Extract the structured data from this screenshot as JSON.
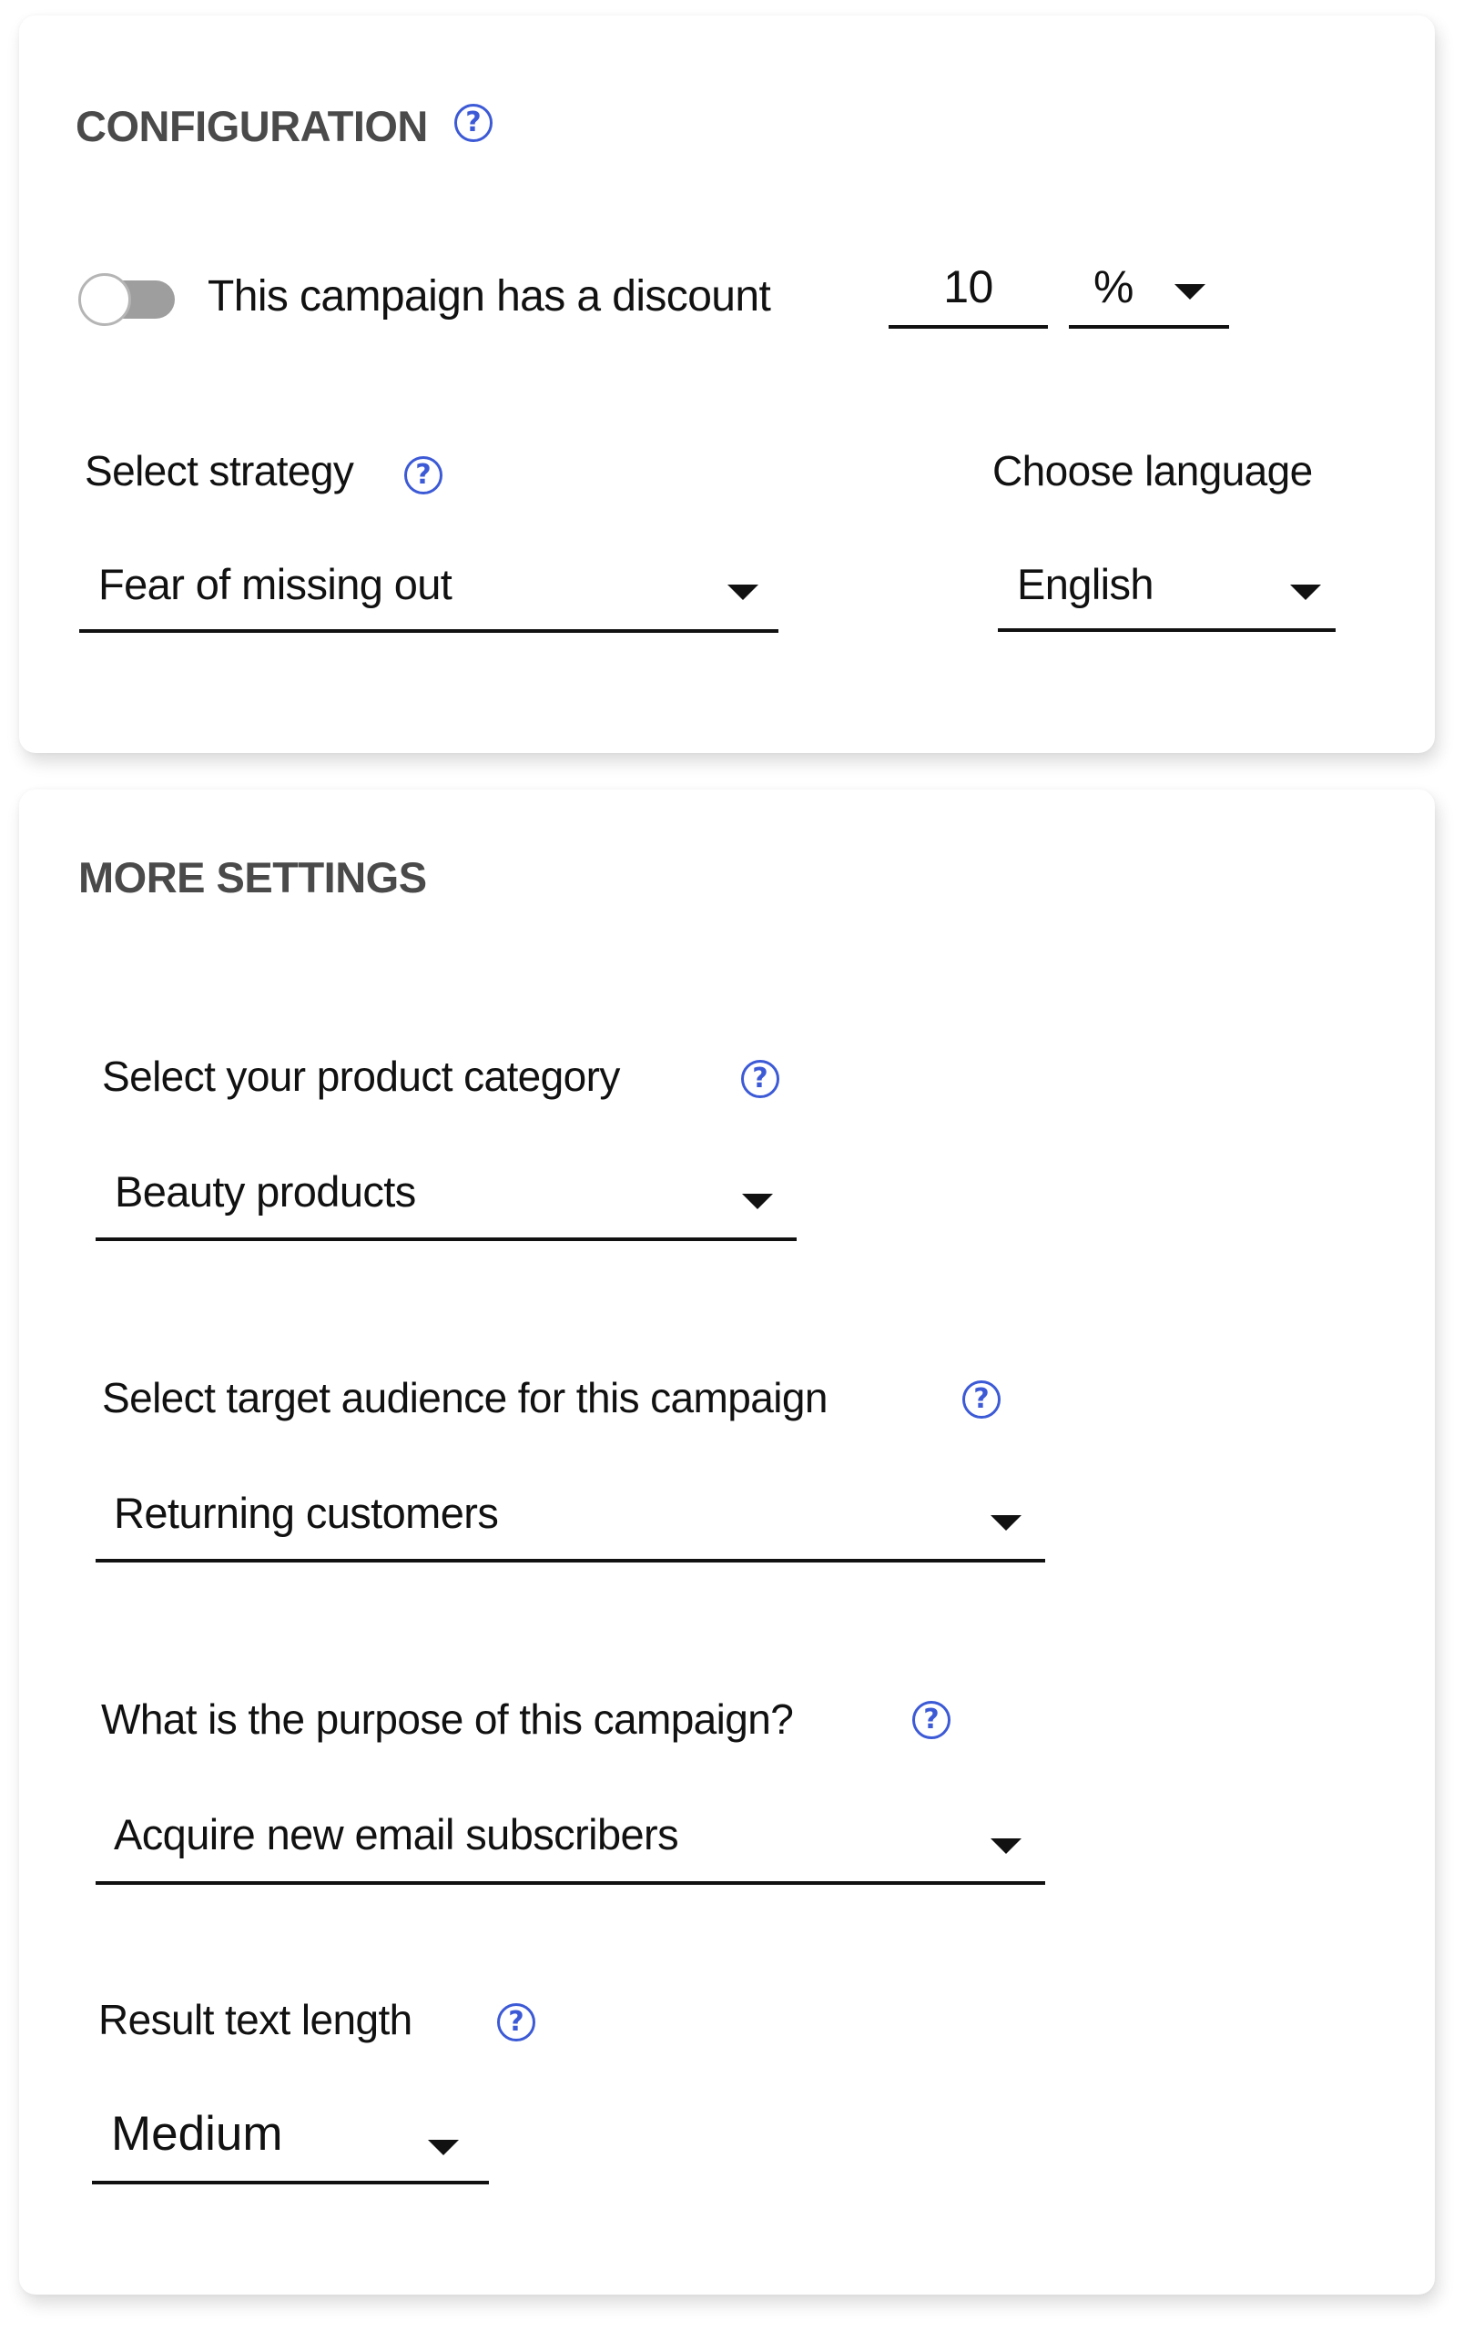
{
  "configuration": {
    "title": "CONFIGURATION",
    "help_icon": "question-circle-icon",
    "discount_toggle": {
      "label": "This campaign has a discount",
      "checked": false
    },
    "discount_amount": {
      "value": "10"
    },
    "discount_unit": {
      "value": "%"
    },
    "strategy": {
      "label": "Select strategy",
      "value": "Fear of missing out"
    },
    "language": {
      "label": "Choose language",
      "value": "English"
    }
  },
  "more_settings": {
    "title": "MORE SETTINGS",
    "product_category": {
      "label": "Select your product category",
      "value": "Beauty products"
    },
    "target_audience": {
      "label": "Select target audience for this campaign",
      "value": "Returning customers"
    },
    "purpose": {
      "label": "What is the purpose of this campaign?",
      "value": "Acquire new email subscribers"
    },
    "text_length": {
      "label": "Result text length",
      "value": "Medium"
    }
  },
  "icons": {
    "help": "?"
  },
  "colors": {
    "accent": "#3d5ad6",
    "title": "#4a4a4a",
    "toggle_track_off": "#9e9e9e",
    "text": "#111111"
  }
}
